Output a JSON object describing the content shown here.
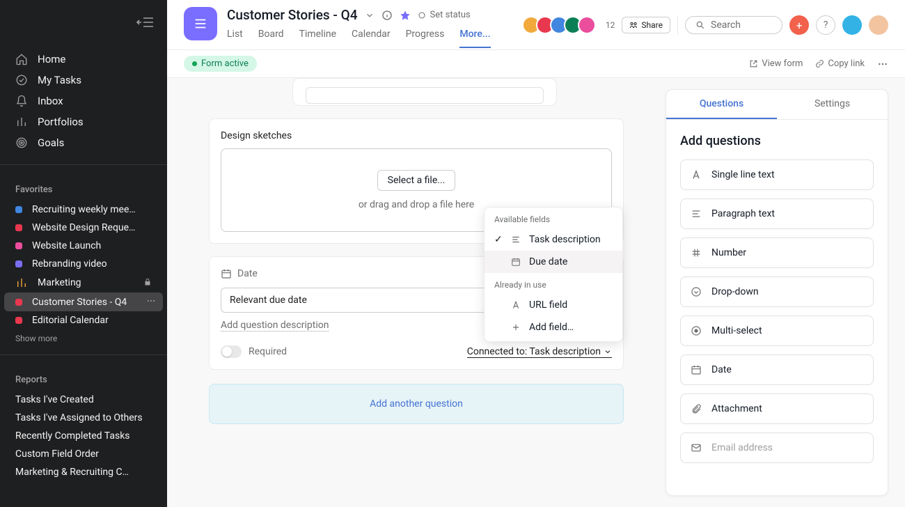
{
  "sidebar": {
    "nav": [
      {
        "id": "home",
        "label": "Home",
        "icon": "home"
      },
      {
        "id": "tasks",
        "label": "My Tasks",
        "icon": "check"
      },
      {
        "id": "inbox",
        "label": "Inbox",
        "icon": "bell"
      },
      {
        "id": "portfolios",
        "label": "Portfolios",
        "icon": "bars"
      },
      {
        "id": "goals",
        "label": "Goals",
        "icon": "target"
      }
    ],
    "favorites_label": "Favorites",
    "favorites": [
      {
        "label": "Recruiting weekly mee…",
        "color": "#4186e0"
      },
      {
        "label": "Website Design Reque…",
        "color": "#e8384f"
      },
      {
        "label": "Website Launch",
        "color": "#ea4e9d"
      },
      {
        "label": "Rebranding video",
        "color": "#7a6ff0"
      },
      {
        "label": "Marketing",
        "color": "#f2a93b",
        "extra": "lock"
      },
      {
        "label": "Customer Stories - Q4",
        "color": "#e8384f",
        "active": true,
        "extra": "dots"
      },
      {
        "label": "Editorial Calendar",
        "color": "#e8384f"
      }
    ],
    "show_more": "Show more",
    "reports_label": "Reports",
    "reports": [
      "Tasks I've Created",
      "Tasks I've Assigned to Others",
      "Recently Completed Tasks",
      "Custom Field Order",
      "Marketing & Recruiting C…"
    ]
  },
  "header": {
    "title": "Customer Stories - Q4",
    "set_status": "Set status",
    "tabs": [
      "List",
      "Board",
      "Timeline",
      "Calendar",
      "Progress",
      "More..."
    ],
    "active_tab": 5,
    "avatar_count": "12",
    "share": "Share",
    "search_placeholder": "Search"
  },
  "subheader": {
    "form_active": "Form active",
    "view_form": "View form",
    "copy_link": "Copy link"
  },
  "form": {
    "sketches_label": "Design sketches",
    "select_file": "Select a file...",
    "drag_hint": "or drag and drop a file here",
    "date_label": "Date",
    "date_input_value": "Relevant due date",
    "add_desc": "Add question description",
    "required": "Required",
    "connected": "Connected to: Task description",
    "add_another": "Add another question"
  },
  "popup": {
    "available": "Available fields",
    "task_desc": "Task description",
    "due_date": "Due date",
    "already": "Already in use",
    "url_field": "URL field",
    "add_field": "Add field…"
  },
  "rightpanel": {
    "tab_questions": "Questions",
    "tab_settings": "Settings",
    "add_questions": "Add questions",
    "types": [
      {
        "id": "single",
        "label": "Single line text"
      },
      {
        "id": "para",
        "label": "Paragraph text"
      },
      {
        "id": "number",
        "label": "Number"
      },
      {
        "id": "dropdown",
        "label": "Drop-down"
      },
      {
        "id": "multi",
        "label": "Multi-select"
      },
      {
        "id": "date",
        "label": "Date"
      },
      {
        "id": "attach",
        "label": "Attachment"
      },
      {
        "id": "email",
        "label": "Email address",
        "disabled": true
      }
    ]
  },
  "colors": {
    "avatars": [
      "#f2a93b",
      "#e8384f",
      "#4186e0",
      "#0d7f56",
      "#ea4e9d"
    ]
  }
}
